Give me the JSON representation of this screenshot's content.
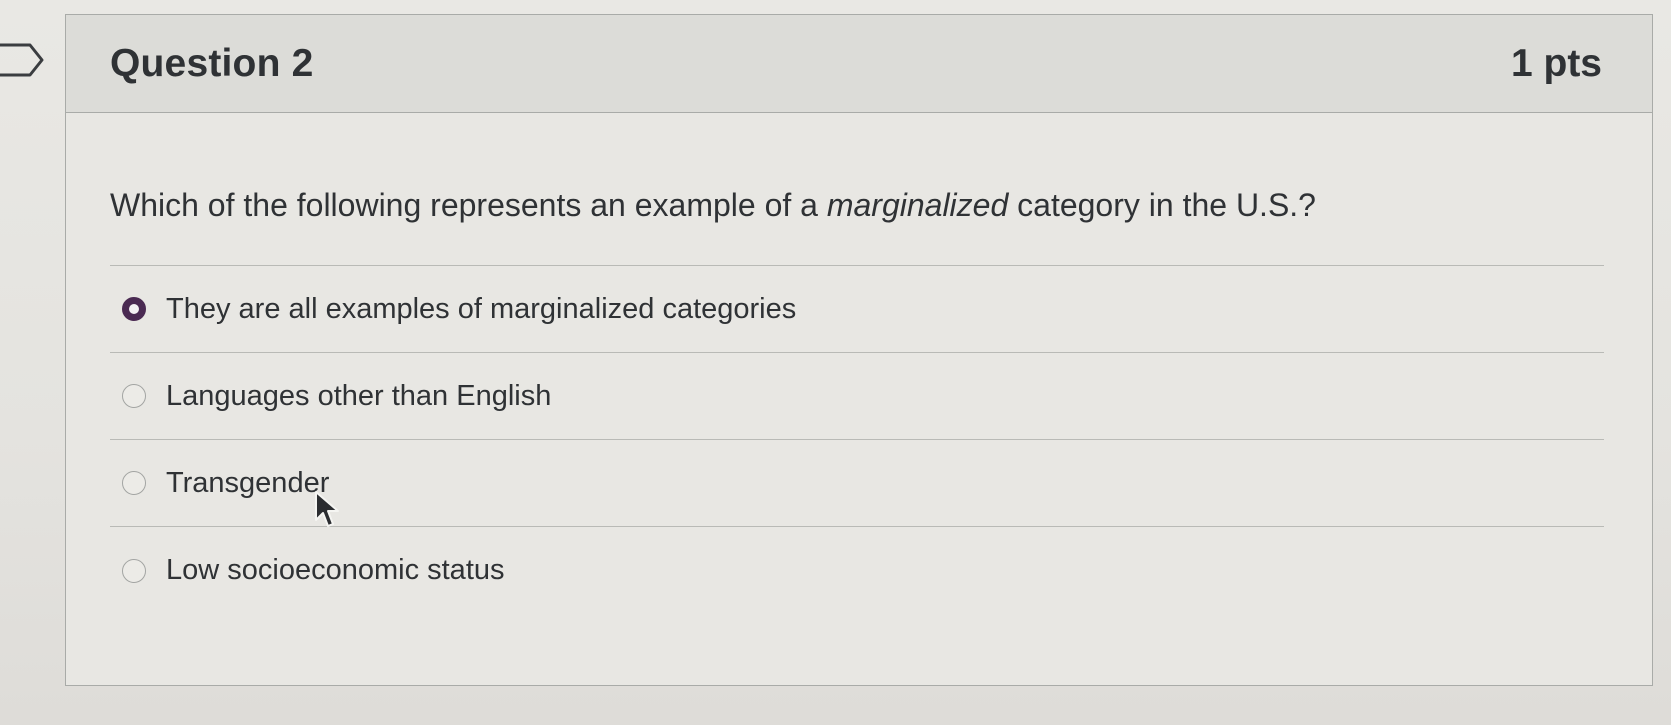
{
  "question": {
    "title": "Question 2",
    "points": "1 pts",
    "text_before": "Which of the following represents an example of a ",
    "text_emphasis": "marginalized",
    "text_after": " category in the U.S.?"
  },
  "answers": [
    {
      "label": "They are all examples of marginalized categories",
      "selected": true
    },
    {
      "label": "Languages other than English",
      "selected": false
    },
    {
      "label": "Transgender",
      "selected": false
    },
    {
      "label": "Low socioeconomic status",
      "selected": false
    }
  ],
  "colors": {
    "selected_radio": "#4a2a52",
    "header_bg": "#dcdcd8",
    "border": "#a9aba8"
  },
  "icons": {
    "flag": "flag-outline-icon",
    "cursor": "mouse-pointer-icon"
  }
}
